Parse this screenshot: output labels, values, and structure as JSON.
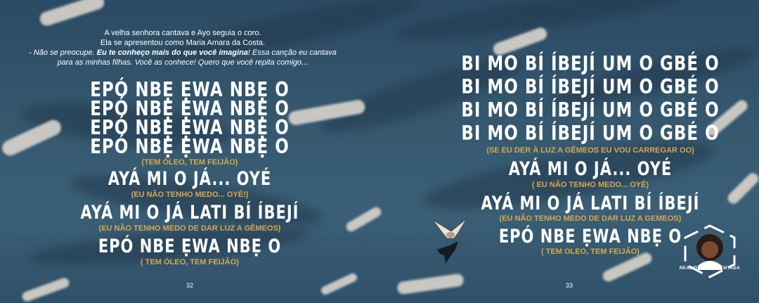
{
  "left_page": {
    "narration": [
      "A velha senhora cantava e Ayo seguia o coro.",
      "Ela se apresentou como Maria Amara da Costa.",
      "- Não se preocupe. Eu te conheço mais do que você imagina! Essa canção eu cantava",
      "para as minhas filhas. Você as conhece! Quero que você repita comigo..."
    ],
    "lyrics": [
      "EPÓ NBẸ ẸWA NBẸ O",
      "EPÓ NBẸ ẸWA NBẸ O",
      "EPÓ NBẸ ẸWA NBẸ O",
      "EPÓ NBẸ ẸWA NBẸ O",
      "(TEM ÓLEO, TEM FEIJÃO)",
      "AYÁ MI O JÁ... OYÉ",
      "(EU NÃO TENHO MEDO... OYÉ!)",
      "AYÁ MI O JÁ LATI BÍ ÍBEJÍ",
      "(EU NÃO TENHO MEDO DE DAR LUZ A GÊMEOS)",
      "EPÓ NBE ẸWA NBẸ O",
      "( TEM ÓLEO, TEM FEIJÃO)"
    ],
    "page_number": "32"
  },
  "right_page": {
    "lyrics": [
      "BI MO BÍ ÍBEJÍ UM  O GBÉ O",
      "BI MO BÍ ÍBEJÍ UM  O GBÉ O",
      "BI MO BÍ ÍBEJÍ UM  O GBÉ O",
      "BI MO BÍ ÍBEJÍ UM  O GBÉ O",
      "(SE EU DER À LUZ A GÊMEOS EU VOU CARREGAR OO)",
      "AYÁ MI O JÁ... OYÉ",
      "( EU NÃO TENHO MEDO... OYÉ)",
      "AYÁ MI O JÁ LATI BÍ ÍBEJÍ",
      "(EU NÃO TENHO MEDO DE DAR LUZ A GEMEOS)",
      "EPÓ NBE ẸWA NBẸ O",
      "( TEM OLEO, TEM FEIJÃO)"
    ],
    "page_number": "33",
    "logo_text": "REALIDADE AUMENTADA"
  },
  "colors": {
    "sky": "#35586f",
    "lyric": "#ffffff",
    "translation": "#d9a74a"
  }
}
